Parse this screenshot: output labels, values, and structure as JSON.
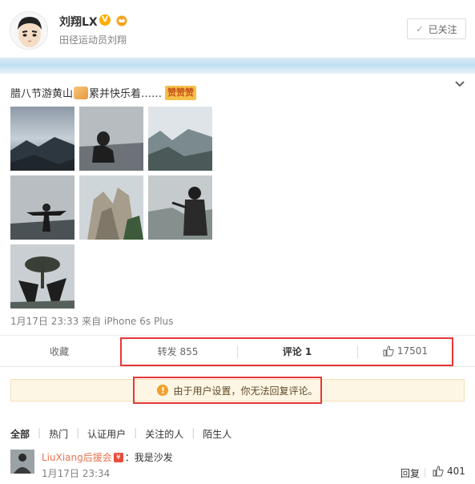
{
  "user": {
    "name": "刘翔LX",
    "description": "田径运动员刘翔",
    "follow_label": "已关注"
  },
  "post": {
    "text_before": "腊八节游黄山",
    "text_after": "累并快乐着……",
    "zan_label": "赞赞赞",
    "meta": "1月17日 23:33 来自 iPhone 6s Plus",
    "icons": [
      "flexed-bicep-icon",
      "expand-chevron-icon"
    ]
  },
  "actions": {
    "collect": "收藏",
    "repost": "转发 855",
    "comment": "评论 1",
    "like_count": "17501"
  },
  "notice": {
    "text": "由于用户设置，你无法回复评论。",
    "icon": "!"
  },
  "comments": {
    "tabs": [
      "全部",
      "热门",
      "认证用户",
      "关注的人",
      "陌生人"
    ],
    "items": [
      {
        "user": "LiuXiang后援会",
        "text": "：我是沙发",
        "time": "1月17日 23:34",
        "reply_label": "回复",
        "like_count": "401"
      }
    ]
  },
  "colors": {
    "accent_red_box": "#e63737",
    "comment_user": "#eb7350",
    "verify_gold": "#ffad00",
    "notice_bg": "#fef6e4"
  }
}
